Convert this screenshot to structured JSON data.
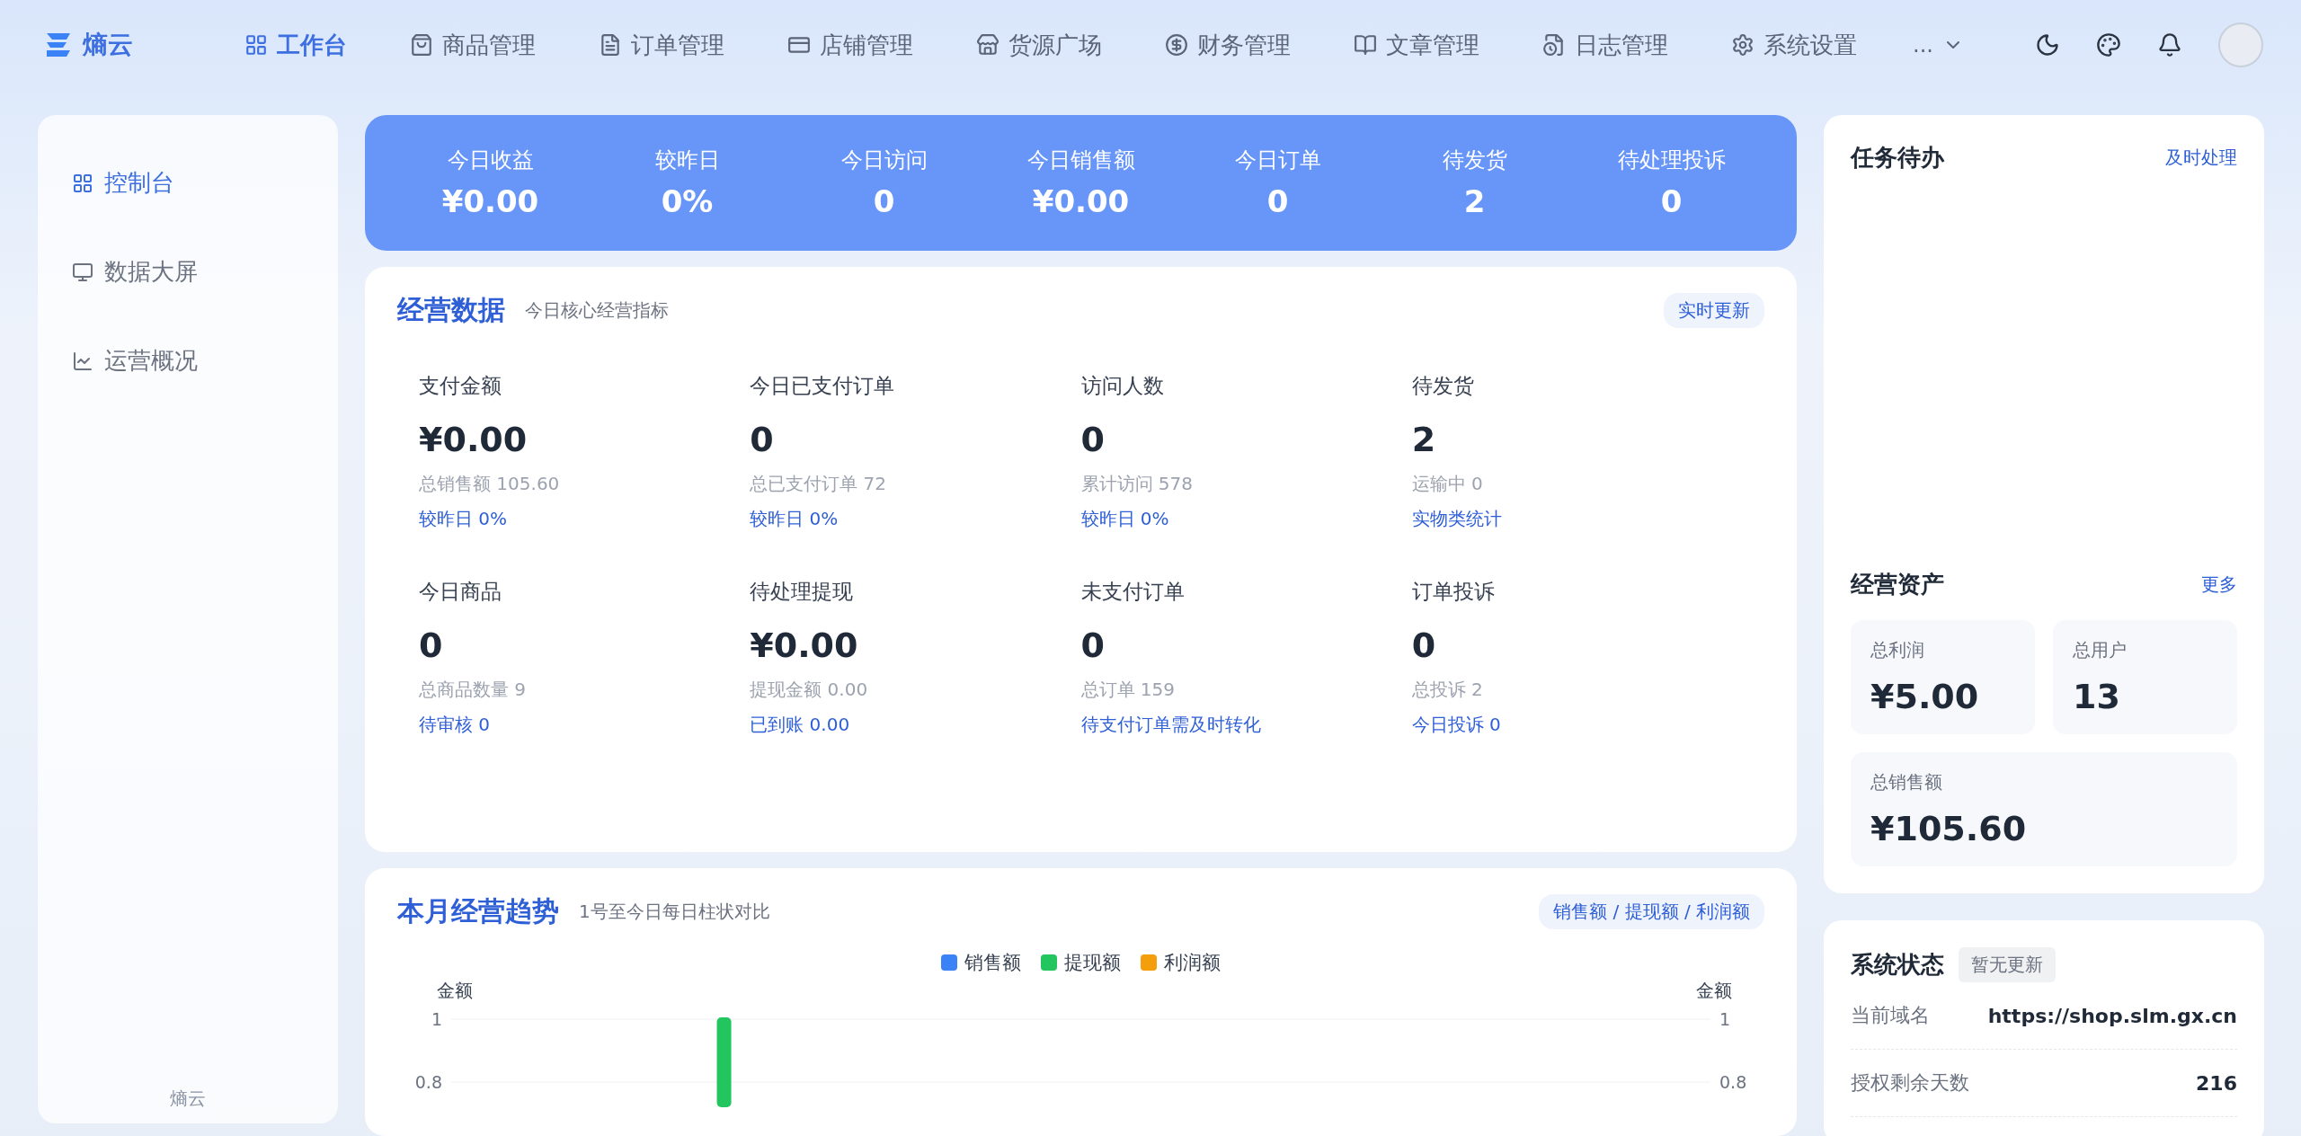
{
  "brand": {
    "name": "熵云"
  },
  "nav": {
    "items": [
      {
        "label": "工作台",
        "selected": true
      },
      {
        "label": "商品管理",
        "selected": false
      },
      {
        "label": "订单管理",
        "selected": false
      },
      {
        "label": "店铺管理",
        "selected": false
      },
      {
        "label": "货源广场",
        "selected": false
      },
      {
        "label": "财务管理",
        "selected": false
      },
      {
        "label": "文章管理",
        "selected": false
      },
      {
        "label": "日志管理",
        "selected": false
      },
      {
        "label": "系统设置",
        "selected": false
      }
    ],
    "more": "..."
  },
  "sidebar": {
    "items": [
      {
        "label": "控制台",
        "selected": true
      },
      {
        "label": "数据大屏",
        "selected": false
      },
      {
        "label": "运营概况",
        "selected": false
      }
    ],
    "footer": "熵云"
  },
  "summary": [
    {
      "label": "今日收益",
      "value": "¥0.00"
    },
    {
      "label": "较昨日",
      "value": "0%"
    },
    {
      "label": "今日访问",
      "value": "0"
    },
    {
      "label": "今日销售额",
      "value": "¥0.00"
    },
    {
      "label": "今日订单",
      "value": "0"
    },
    {
      "label": "待发货",
      "value": "2"
    },
    {
      "label": "待处理投诉",
      "value": "0"
    }
  ],
  "business": {
    "title": "经营数据",
    "subtitle": "今日核心经营指标",
    "badge": "实时更新",
    "metrics": [
      {
        "label": "支付金额",
        "value": "¥0.00",
        "total": "总销售额 105.60",
        "link": "较昨日 0%"
      },
      {
        "label": "今日已支付订单",
        "value": "0",
        "total": "总已支付订单 72",
        "link": "较昨日 0%"
      },
      {
        "label": "访问人数",
        "value": "0",
        "total": "累计访问 578",
        "link": "较昨日 0%"
      },
      {
        "label": "待发货",
        "value": "2",
        "total": "运输中 0",
        "link": "实物类统计"
      },
      {
        "label": "今日商品",
        "value": "0",
        "total": "总商品数量 9",
        "link": "待审核 0"
      },
      {
        "label": "待处理提现",
        "value": "¥0.00",
        "total": "提现金额 0.00",
        "link": "已到账 0.00"
      },
      {
        "label": "未支付订单",
        "value": "0",
        "total": "总订单 159",
        "link": "待支付订单需及时转化"
      },
      {
        "label": "订单投诉",
        "value": "0",
        "total": "总投诉 2",
        "link": "今日投诉 0"
      }
    ]
  },
  "trend": {
    "title": "本月经营趋势",
    "subtitle": "1号至今日每日柱状对比",
    "badge": "销售额 / 提现额 / 利润额",
    "chart_data": {
      "type": "bar",
      "ylabel": "金额",
      "yticks": [
        0.8,
        1
      ],
      "ylim": [
        0.8,
        1
      ],
      "series": [
        {
          "name": "销售额",
          "color": "#3b82f6",
          "values": [
            null,
            null,
            null,
            null,
            null,
            null,
            null,
            null,
            null,
            null,
            null,
            null,
            null,
            null,
            null,
            null,
            null,
            null,
            null,
            null,
            null,
            null,
            null,
            null,
            null,
            null,
            null,
            null,
            null,
            null
          ]
        },
        {
          "name": "提现额",
          "color": "#22c55e",
          "values": [
            null,
            null,
            null,
            null,
            null,
            null,
            1,
            null,
            null,
            null,
            null,
            null,
            null,
            null,
            null,
            null,
            null,
            null,
            null,
            null,
            null,
            null,
            null,
            null,
            null,
            null,
            null,
            null,
            null,
            null
          ]
        },
        {
          "name": "利润额",
          "color": "#f59e0b",
          "values": [
            null,
            null,
            null,
            null,
            null,
            null,
            null,
            null,
            null,
            null,
            null,
            null,
            null,
            null,
            null,
            null,
            null,
            null,
            null,
            null,
            null,
            null,
            null,
            null,
            null,
            null,
            null,
            null,
            null,
            null
          ]
        }
      ]
    },
    "right_axis_label": "金额",
    "right_ticks": [
      "1",
      "0.8"
    ]
  },
  "tasks": {
    "title": "任务待办",
    "action": "及时处理"
  },
  "assets": {
    "title": "经营资产",
    "action": "更多",
    "items": [
      {
        "label": "总利润",
        "value": "¥5.00"
      },
      {
        "label": "总用户",
        "value": "13"
      },
      {
        "label": "总销售额",
        "value": "¥105.60"
      }
    ]
  },
  "system": {
    "title": "系统状态",
    "badge": "暂无更新",
    "rows": [
      {
        "label": "当前域名",
        "value": "https://shop.slm.gx.cn"
      },
      {
        "label": "授权剩余天数",
        "value": "216"
      }
    ]
  }
}
